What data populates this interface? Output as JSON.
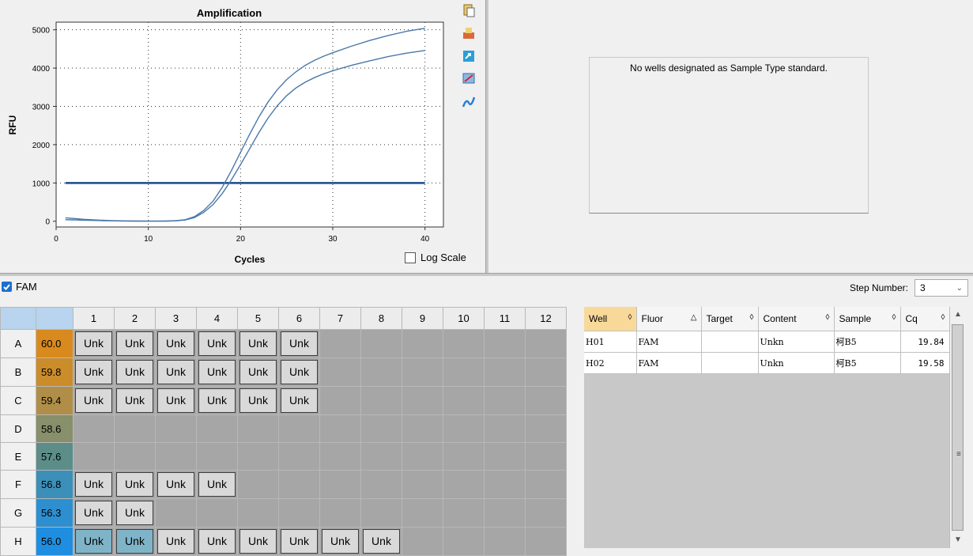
{
  "chart_data": {
    "type": "line",
    "title": "Amplification",
    "xlabel": "Cycles",
    "ylabel": "RFU",
    "xlim": [
      0,
      42
    ],
    "ylim": [
      -150,
      5200
    ],
    "xticks": [
      0,
      10,
      20,
      30,
      40
    ],
    "yticks": [
      0,
      1000,
      2000,
      3000,
      4000,
      5000
    ],
    "grid": true,
    "threshold": 1000,
    "series": [
      {
        "x": [
          1,
          2,
          3,
          4,
          5,
          6,
          7,
          8,
          9,
          10,
          11,
          12,
          13,
          14,
          15,
          16,
          17,
          18,
          19,
          20,
          21,
          22,
          23,
          24,
          25,
          26,
          27,
          28,
          29,
          30,
          32,
          34,
          36,
          38,
          40
        ],
        "values": [
          90,
          70,
          50,
          35,
          25,
          18,
          12,
          8,
          5,
          3,
          2,
          5,
          15,
          40,
          120,
          280,
          520,
          880,
          1320,
          1800,
          2280,
          2730,
          3120,
          3440,
          3700,
          3900,
          4070,
          4200,
          4310,
          4400,
          4570,
          4720,
          4850,
          4960,
          5040
        ]
      },
      {
        "x": [
          1,
          2,
          3,
          4,
          5,
          6,
          7,
          8,
          9,
          10,
          11,
          12,
          13,
          14,
          15,
          16,
          17,
          18,
          19,
          20,
          21,
          22,
          23,
          24,
          25,
          26,
          27,
          28,
          29,
          30,
          32,
          34,
          36,
          38,
          40
        ],
        "values": [
          40,
          35,
          28,
          22,
          16,
          12,
          8,
          5,
          3,
          2,
          2,
          4,
          12,
          32,
          95,
          230,
          430,
          720,
          1080,
          1480,
          1900,
          2320,
          2700,
          3020,
          3280,
          3480,
          3630,
          3750,
          3850,
          3930,
          4070,
          4190,
          4300,
          4390,
          4460
        ]
      }
    ]
  },
  "log_scale_label": "Log Scale",
  "standard_message": "No wells designated as Sample Type standard.",
  "fluor_checkbox_label": "FAM",
  "step": {
    "label": "Step Number:",
    "value": "3"
  },
  "plate": {
    "columns": [
      "1",
      "2",
      "3",
      "4",
      "5",
      "6",
      "7",
      "8",
      "9",
      "10",
      "11",
      "12"
    ],
    "rows": [
      {
        "label": "A",
        "temp": "60.0",
        "tempColor": "#d98a1e",
        "wells": [
          "Unk",
          "Unk",
          "Unk",
          "Unk",
          "Unk",
          "Unk",
          "",
          "",
          "",
          "",
          "",
          ""
        ]
      },
      {
        "label": "B",
        "temp": "59.8",
        "tempColor": "#cb8c2a",
        "wells": [
          "Unk",
          "Unk",
          "Unk",
          "Unk",
          "Unk",
          "Unk",
          "",
          "",
          "",
          "",
          "",
          ""
        ]
      },
      {
        "label": "C",
        "temp": "59.4",
        "tempColor": "#b18e47",
        "wells": [
          "Unk",
          "Unk",
          "Unk",
          "Unk",
          "Unk",
          "Unk",
          "",
          "",
          "",
          "",
          "",
          ""
        ]
      },
      {
        "label": "D",
        "temp": "58.6",
        "tempColor": "#878f6b",
        "wells": [
          "",
          "",
          "",
          "",
          "",
          "",
          "",
          "",
          "",
          "",
          "",
          ""
        ]
      },
      {
        "label": "E",
        "temp": "57.6",
        "tempColor": "#5c8d89",
        "wells": [
          "",
          "",
          "",
          "",
          "",
          "",
          "",
          "",
          "",
          "",
          "",
          ""
        ]
      },
      {
        "label": "F",
        "temp": "56.8",
        "tempColor": "#3c8fb8",
        "wells": [
          "Unk",
          "Unk",
          "Unk",
          "Unk",
          "",
          "",
          "",
          "",
          "",
          "",
          "",
          ""
        ]
      },
      {
        "label": "G",
        "temp": "56.3",
        "tempColor": "#2d8fd0",
        "wells": [
          "Unk",
          "Unk",
          "",
          "",
          "",
          "",
          "",
          "",
          "",
          "",
          "",
          ""
        ]
      },
      {
        "label": "H",
        "temp": "56.0",
        "tempColor": "#1f8ee0",
        "wells": [
          "Unk",
          "Unk",
          "Unk",
          "Unk",
          "Unk",
          "Unk",
          "Unk",
          "Unk",
          "",
          "",
          "",
          ""
        ],
        "selected": [
          0,
          1
        ]
      }
    ]
  },
  "results": {
    "headers": [
      "Well",
      "Fluor",
      "Target",
      "Content",
      "Sample",
      "Cq"
    ],
    "sort_icons": [
      "◊",
      "△",
      "◊",
      "◊",
      "◊",
      "◊"
    ],
    "rows": [
      [
        "H01",
        "FAM",
        "",
        "Unkn",
        "柯B5",
        "19.84"
      ],
      [
        "H02",
        "FAM",
        "",
        "Unkn",
        "柯B5",
        "19.58"
      ]
    ]
  }
}
